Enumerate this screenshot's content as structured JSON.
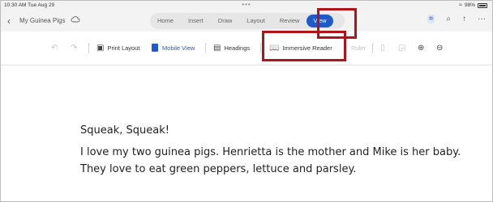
{
  "status": {
    "time": "10:30 AM  Tue Aug 29",
    "dots": "•••",
    "battery": "98%",
    "wifi_icon": "wifi-icon"
  },
  "title_bar": {
    "back_icon": "‹",
    "doc_title": "My Guinea Pigs",
    "tabs": [
      "Home",
      "Insert",
      "Draw",
      "Layout",
      "Review",
      "View"
    ],
    "active_tab": "View",
    "focus_icon": "⌗",
    "search_icon": "⌕",
    "share_icon": "↑",
    "more_icon": "···"
  },
  "ribbon": {
    "undo_icon": "↶",
    "redo_icon": "↷",
    "print_layout": "Print Layout",
    "mobile_view": "Mobile View",
    "headings": "Headings",
    "immersive_reader": "Immersive Reader",
    "ruler": "Ruler",
    "zoom_in_icon": "⊕",
    "zoom_out_icon": "⊖"
  },
  "document": {
    "heading": "Squeak, Squeak!",
    "body": "I love my two guinea pigs.  Henrietta is the mother and Mike is her baby.  They love to eat green peppers, lettuce and parsley."
  },
  "colors": {
    "accent": "#1f5bc8",
    "highlight": "#b3121b"
  }
}
